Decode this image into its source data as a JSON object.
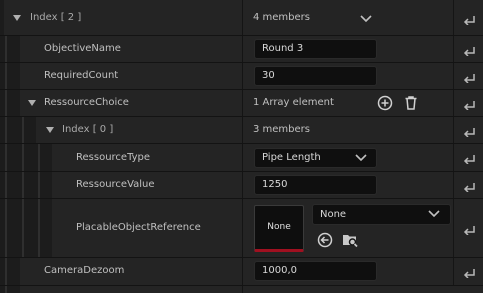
{
  "rows": {
    "index2": {
      "label": "Index [ 2 ]",
      "value": "4 members"
    },
    "objective_name": {
      "label": "ObjectiveName",
      "value": "Round 3"
    },
    "required_count": {
      "label": "RequiredCount",
      "value": "30"
    },
    "ressource_choice": {
      "label": "RessourceChoice",
      "value": "1 Array element"
    },
    "index0": {
      "label": "Index [ 0 ]",
      "value": "3 members"
    },
    "ressource_type": {
      "label": "RessourceType",
      "value": "Pipe Length"
    },
    "ressource_value": {
      "label": "RessourceValue",
      "value": "1250"
    },
    "placable_ref": {
      "label": "PlacableObjectReference",
      "thumb_text": "None",
      "value": "None"
    },
    "camera_dezoom": {
      "label": "CameraDezoom",
      "value": "1000,0"
    }
  },
  "icons": {
    "reset": "reset-to-default-icon",
    "add": "add-element-icon",
    "delete": "trash-icon",
    "use_selected": "use-selected-asset-icon",
    "browse": "browse-to-asset-icon"
  },
  "colors": {
    "thumb_accent": "#a01020",
    "panel_bg": "#242424"
  }
}
